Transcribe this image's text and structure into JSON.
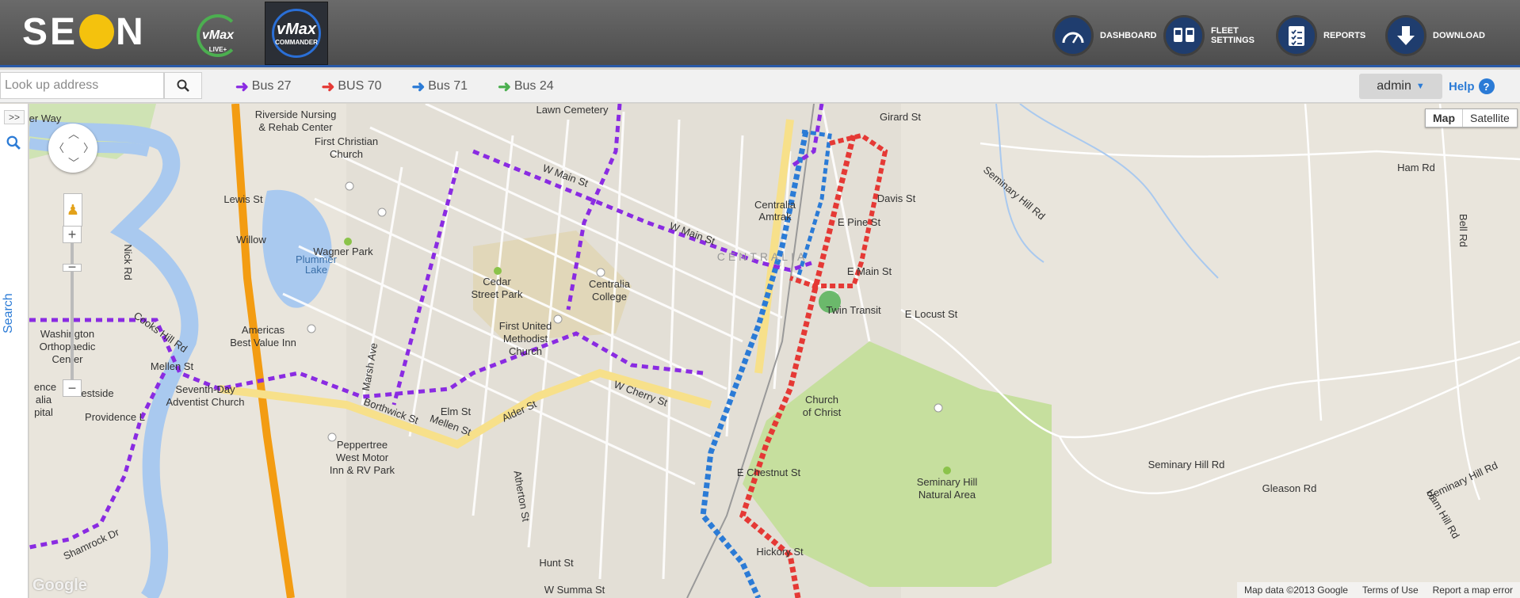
{
  "header": {
    "logo_text_left": "SE",
    "logo_text_right": "N",
    "apps": [
      {
        "label": "vMax",
        "sub": "LIVE+"
      },
      {
        "label": "vMax",
        "sub": "COMMANDER"
      }
    ],
    "nav": [
      {
        "label": "DASHBOARD",
        "icon": "speedometer-icon"
      },
      {
        "label": "FLEET SETTINGS",
        "icon": "buses-icon"
      },
      {
        "label": "REPORTS",
        "icon": "clipboard-icon"
      },
      {
        "label": "DOWNLOAD",
        "icon": "download-icon"
      }
    ]
  },
  "toolbar": {
    "search_placeholder": "Look up address",
    "buses": [
      {
        "label": "Bus 27",
        "color": "#8a2be2"
      },
      {
        "label": "BUS 70",
        "color": "#e53935"
      },
      {
        "label": "Bus 71",
        "color": "#2b7bd6"
      },
      {
        "label": "Bus 24",
        "color": "#4caf50"
      }
    ],
    "user": "admin",
    "help": "Help"
  },
  "side": {
    "expand": ">>",
    "search_label": "Search"
  },
  "map": {
    "type_buttons": [
      "Map",
      "Satellite"
    ],
    "google_mark": "Google",
    "footer": [
      "Map data ©2013 Google",
      "Terms of Use",
      "Report a map error"
    ],
    "labels": {
      "cemetery": "Lawn Cemetery",
      "nursing": "Riverside Nursing",
      "nursing2": "& Rehab Center",
      "church1": "First Christian",
      "church1b": "Church",
      "wagner": "Wagner Park",
      "plummer": "Plummer",
      "plummer2": "Lake",
      "cedar": "Cedar",
      "cedar2": "Street Park",
      "college": "Centralia",
      "college2": "College",
      "amtrak": "Centralia",
      "amtrak2": "Amtrak",
      "centralia": "CENTRALIA",
      "transit": "Twin Transit",
      "methodist": "First United",
      "methodist2": "Methodist",
      "methodist3": "Church",
      "americas": "Americas",
      "americas2": "Best Value Inn",
      "washington": "Washington",
      "washington2": "Orthopaedic",
      "washington3": "Center",
      "adventist": "Seventh-Day",
      "adventist2": "Adventist Church",
      "peppertree": "Peppertree",
      "peppertree2": "West Motor",
      "peppertree3": "Inn & RV Park",
      "christ": "Church",
      "christ2": "of Christ",
      "seminary": "Seminary Hill",
      "seminary2": "Natural Area",
      "mainst": "W Main St",
      "mainst2": "W Main St",
      "cherry": "W Cherry St",
      "mellen": "Mellen St",
      "alder": "Alder St",
      "hamrd": "Ham Rd",
      "girard": "Girard St",
      "davis": "Davis St",
      "epine": "E Pine St",
      "emain": "E Main St",
      "elocust": "E Locust St",
      "echestnut": "E Chestnut St",
      "hickory": "Hickory St",
      "summa": "W Summa St",
      "hunt": "Hunt St",
      "atherton": "Atherton St",
      "seminaryhillrd": "Seminary Hill Rd",
      "seminaryhillrd2": "Seminary Hill Rd",
      "seminaryhillrd3": "Seminary Hill Rd",
      "gleason": "Gleason Rd",
      "hamhill": "Ham Hill Rd",
      "bellrd": "Bell Rd",
      "nickrd": "Nick Rd",
      "lewis": "Lewis St",
      "willow": "Willow",
      "borthwick": "Borthwick St",
      "westside": "Westside",
      "providence": "Providence L",
      "shamrock": "Shamrock Dr",
      "mellenst2": "Mellen St",
      "elmst": "Elm St",
      "marsh": "Marsh Ave",
      "cooks": "Cooks Hill Rd",
      "ence": "ence",
      "alia": "alia",
      "pital": "pital",
      "rway": "er Way"
    }
  }
}
